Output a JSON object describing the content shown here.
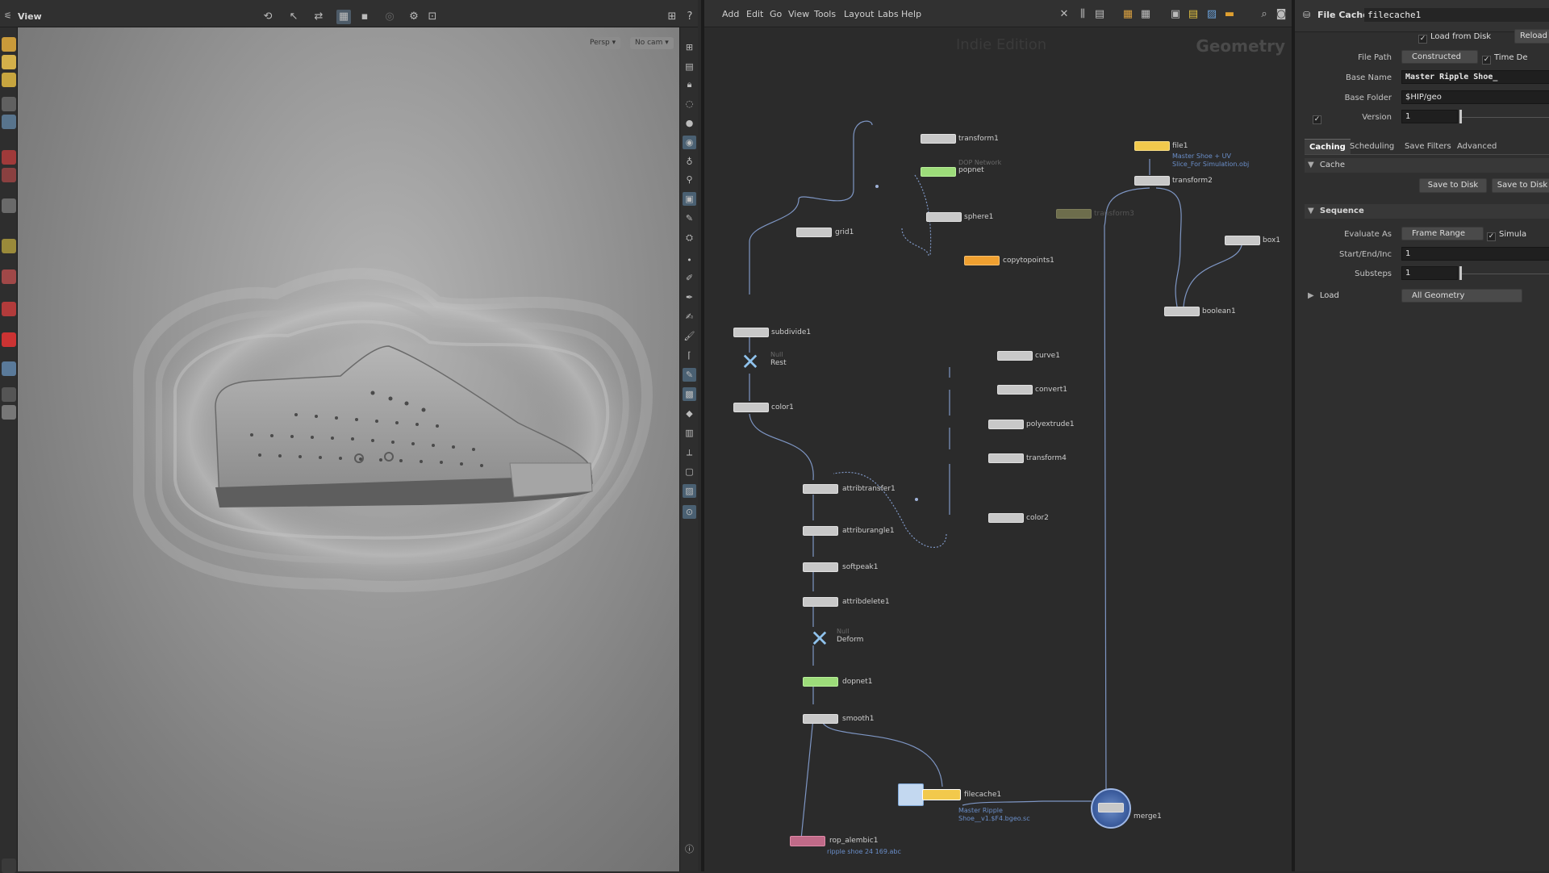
{
  "viewport": {
    "title": "View",
    "camera_persp": "Persp ▾",
    "camera_cam": "No cam ▾"
  },
  "network": {
    "menu": [
      "Add",
      "Edit",
      "Go",
      "View",
      "Tools",
      "Layout",
      "Labs",
      "Help"
    ],
    "edition": "Indie Edition",
    "context": "Geometry",
    "nodes": {
      "transform1": "transform1",
      "popnet_sub": "DOP Network",
      "popnet": "popnet",
      "sphere1": "sphere1",
      "grid1": "grid1",
      "copytopoints1": "copytopoints1",
      "file1": "file1",
      "file1_comment": "Master Shoe + UV Slice_For Simulation.obj",
      "transform2": "transform2",
      "transform3": "transform3",
      "box1": "box1",
      "boolean1": "boolean1",
      "subdivide1": "subdivide1",
      "rest_sub": "Null",
      "rest": "Rest",
      "color1": "color1",
      "curve1": "curve1",
      "convert1": "convert1",
      "polyextrude1": "polyextrude1",
      "transform4": "transform4",
      "color2": "color2",
      "attribtransfer1": "attribtransfer1",
      "attriburangle1": "attriburangle1",
      "softpeak1": "softpeak1",
      "attribdelete1": "attribdelete1",
      "deform_sub": "Null",
      "deform": "Deform",
      "dopnet1": "dopnet1",
      "smooth1": "smooth1",
      "filecache1": "filecache1",
      "filecache1_comment": "Master Ripple Shoe__v1.$F4.bgeo.sc",
      "merge1": "merge1",
      "rop_alembic1": "rop_alembic1",
      "rop_comment": "ripple shoe 24 169.abc"
    }
  },
  "params": {
    "node_type": "File Cache",
    "node_name": "filecache1",
    "load_from_disk": "Load from Disk",
    "reload": "Reload",
    "file_path_label": "File Path",
    "file_path_value": "Constructed",
    "time_dep": "Time De",
    "base_name_label": "Base Name",
    "base_name_value": "Master Ripple Shoe_",
    "base_folder_label": "Base Folder",
    "base_folder_value": "$HIP/geo",
    "version_label": "Version",
    "version_value": "1",
    "tabs": [
      "Caching",
      "Scheduling",
      "Save Filters",
      "Advanced"
    ],
    "cache_section": "Cache",
    "save_to_disk": "Save to Disk",
    "save_to_disk2": "Save to Disk",
    "sequence_section": "Sequence",
    "evaluate_as_label": "Evaluate As",
    "evaluate_as_value": "Frame Range",
    "simulation": "Simula",
    "start_end_label": "Start/End/Inc",
    "start_end_value": "1",
    "substeps_label": "Substeps",
    "substeps_value": "1",
    "load_section": "Load",
    "load_value": "All Geometry"
  },
  "colors": {
    "accent_yellow": "#f2c94c",
    "accent_orange": "#f0a030",
    "accent_green": "#9ddc7a",
    "wire": "#7e96c4",
    "null_blue": "#8fc2ec"
  }
}
